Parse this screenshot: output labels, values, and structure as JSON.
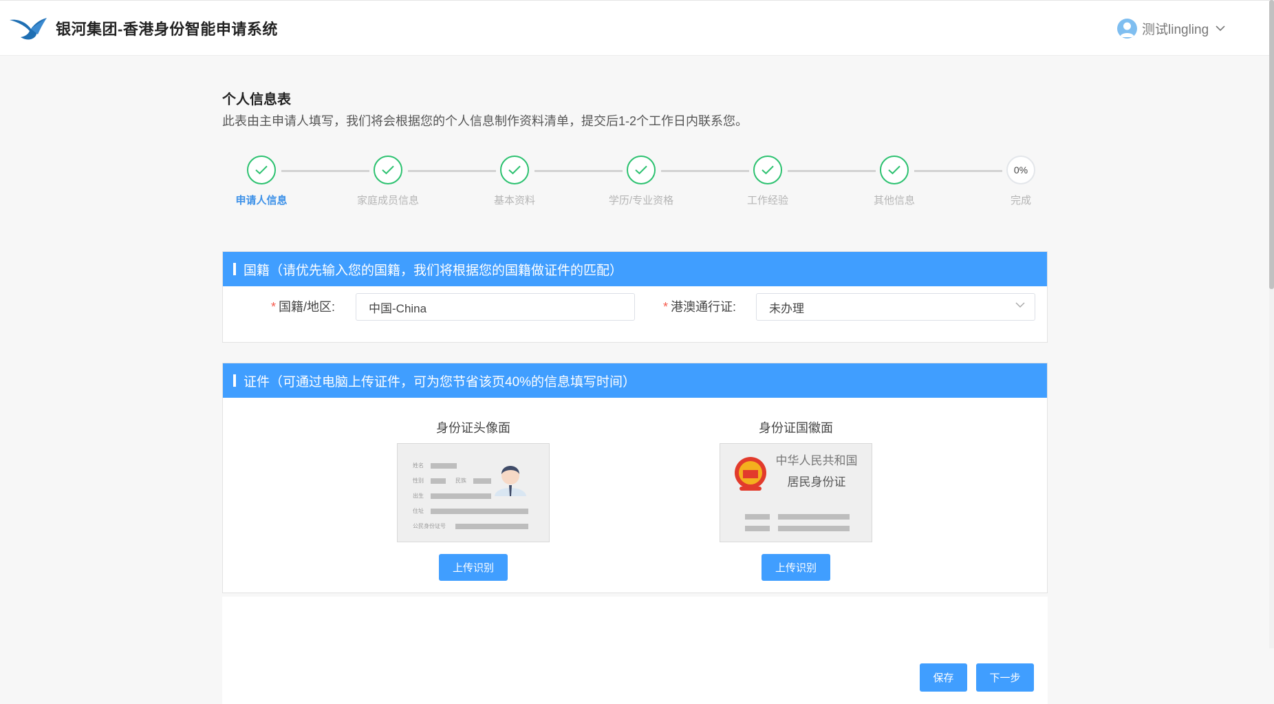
{
  "header": {
    "brand_title": "银河集团-香港身份智能申请系统",
    "user_name": "测试lingling"
  },
  "form": {
    "title": "个人信息表",
    "description": "此表由主申请人填写，我们将会根据您的个人信息制作资料清单，提交后1-2个工作日内联系您。"
  },
  "steps": [
    {
      "label": "申请人信息",
      "status": "done",
      "active": true
    },
    {
      "label": "家庭成员信息",
      "status": "done"
    },
    {
      "label": "基本资料",
      "status": "done"
    },
    {
      "label": "学历/专业资格",
      "status": "done"
    },
    {
      "label": "工作经验",
      "status": "done"
    },
    {
      "label": "其他信息",
      "status": "done"
    },
    {
      "label": "完成",
      "status": "pending",
      "progress_text": "0%"
    }
  ],
  "nationality_section": {
    "title": "国籍（请优先输入您的国籍，我们将根据您的国籍做证件的匹配）",
    "required_mark": "*",
    "nationality_label": "国籍/地区:",
    "nationality_value": "中国-China",
    "permit_label": "港澳通行证:",
    "permit_value": "未办理"
  },
  "document_section": {
    "title": "证件（可通过电脑上传证件，可为您节省该页40%的信息填写时间）",
    "front": {
      "title": "身份证头像面",
      "fields": [
        "姓名",
        "性别",
        "民族",
        "出生",
        "住址",
        "公民身份证号"
      ],
      "button": "上传识别"
    },
    "back": {
      "title": "身份证国徽面",
      "line1": "中华人民共和国",
      "line2": "居民身份证",
      "button": "上传识别"
    }
  },
  "actions": {
    "save": "保存",
    "next": "下一步"
  },
  "colors": {
    "primary": "#409eff",
    "success": "#2bc16f",
    "active_step": "#3d91e8",
    "required": "#f5584b"
  }
}
